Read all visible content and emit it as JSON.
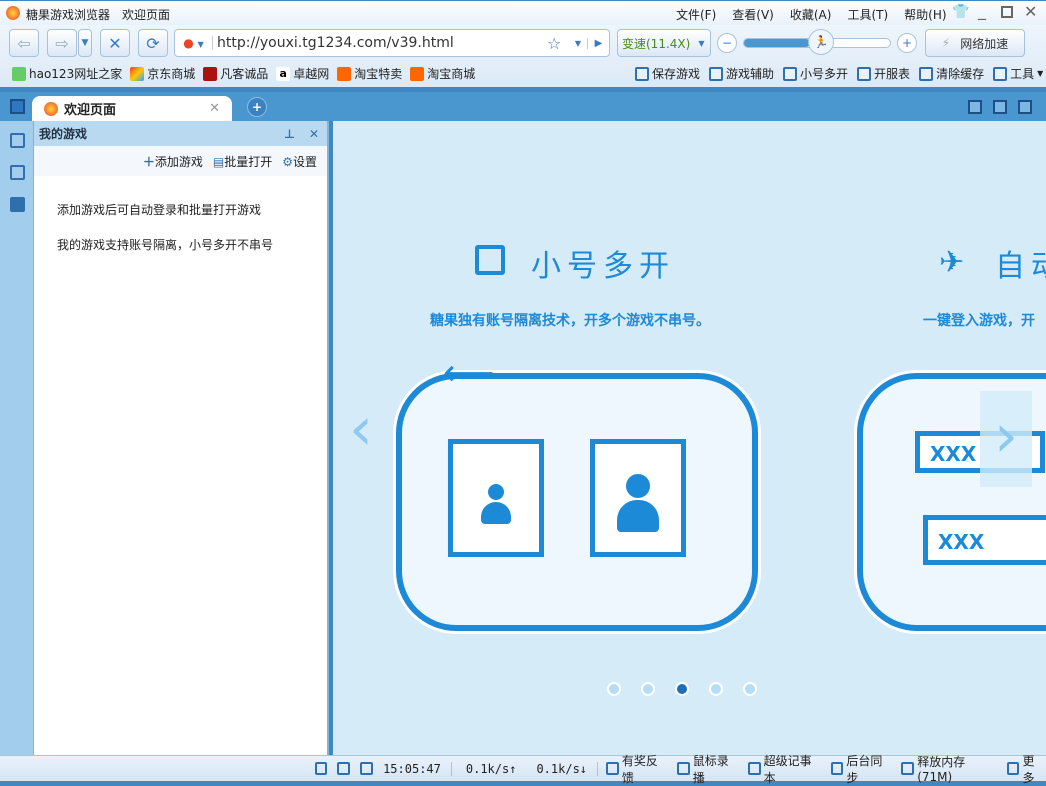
{
  "title": {
    "app": "糖果游戏浏览器",
    "page": "欢迎页面"
  },
  "menu": [
    "文件(F)",
    "查看(V)",
    "收藏(A)",
    "工具(T)",
    "帮助(H)"
  ],
  "toolbar": {
    "url": "http://youxi.tg1234.com/v39.html",
    "speed": "变速(11.4X)",
    "speed_value": 0.5,
    "accelerate": "网络加速"
  },
  "bookmarks": [
    "hao123网址之家",
    "京东商城",
    "凡客诚品",
    "卓越网",
    "淘宝特卖",
    "淘宝商城"
  ],
  "tools": [
    "保存游戏",
    "游戏辅助",
    "小号多开",
    "开服表",
    "清除缓存",
    "工具"
  ],
  "tab": {
    "label": "欢迎页面"
  },
  "panel": {
    "title": "我的游戏",
    "add": "添加游戏",
    "batch": "批量打开",
    "settings": "设置",
    "tips": [
      "添加游戏后可自动登录和批量打开游戏",
      "我的游戏支持账号隔离，小号多开不串号"
    ]
  },
  "slide": {
    "title": "小号多开",
    "subtitle": "糖果独有账号隔离技术，开多个游戏不串号。",
    "next_title": "自动",
    "next_subtitle": "一键登入游戏，开",
    "card_text": [
      "XXX",
      "XXX"
    ],
    "active_dot": 3,
    "dots": 5
  },
  "status": {
    "time": "15:05:47",
    "up": "0.1k/s↑",
    "down": "0.1k/s↓",
    "items": [
      "有奖反馈",
      "鼠标录播",
      "超级记事本",
      "后台同步",
      "释放内存(71M)",
      "更多"
    ]
  }
}
